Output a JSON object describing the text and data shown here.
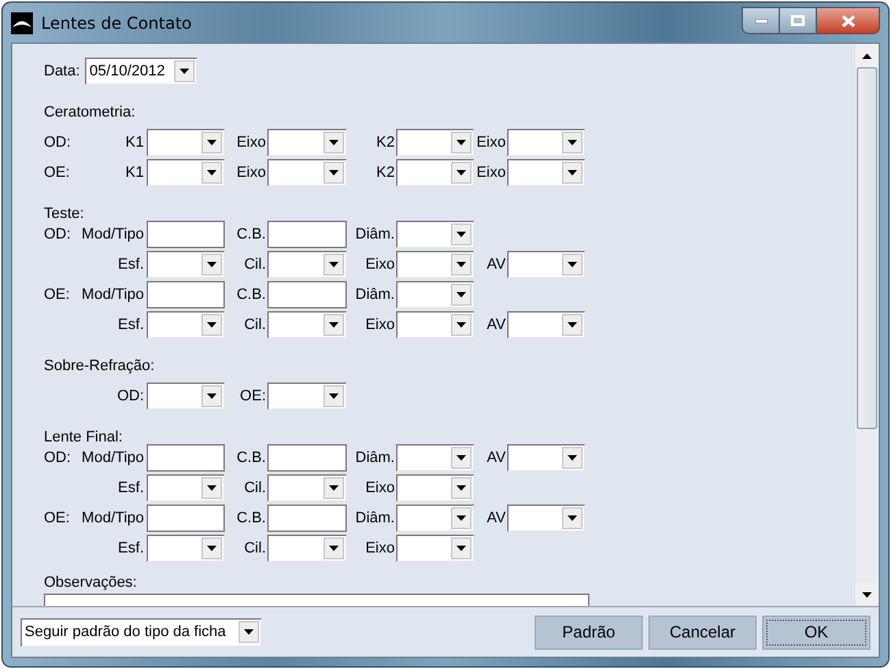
{
  "window": {
    "title": "Lentes de Contato"
  },
  "date": {
    "label": "Data:",
    "value": "05/10/2012"
  },
  "sections": [
    {
      "title": "Ceratometria:",
      "rows": [
        {
          "side": "OD:",
          "fields": [
            {
              "label": "K1",
              "kind": "combo"
            },
            {
              "label": "Eixo",
              "kind": "combo"
            },
            {
              "label": "K2",
              "kind": "combo"
            },
            {
              "label": "Eixo",
              "kind": "combo"
            }
          ]
        },
        {
          "side": "OE:",
          "fields": [
            {
              "label": "K1",
              "kind": "combo"
            },
            {
              "label": "Eixo",
              "kind": "combo"
            },
            {
              "label": "K2",
              "kind": "combo"
            },
            {
              "label": "Eixo",
              "kind": "combo"
            }
          ]
        }
      ]
    },
    {
      "title": "Teste:",
      "rows": [
        {
          "side": "OD:",
          "fields": [
            {
              "label": "Mod/Tipo",
              "kind": "text"
            },
            {
              "label": "C.B.",
              "kind": "text"
            },
            {
              "label": "Diâm.",
              "kind": "combo"
            }
          ]
        },
        {
          "fields": [
            {
              "label": "Esf.",
              "kind": "combo"
            },
            {
              "label": "Cil.",
              "kind": "combo"
            },
            {
              "label": "Eixo",
              "kind": "combo"
            },
            {
              "label": "AV",
              "kind": "combo"
            }
          ]
        },
        {
          "side": "OE:",
          "fields": [
            {
              "label": "Mod/Tipo",
              "kind": "text"
            },
            {
              "label": "C.B.",
              "kind": "text"
            },
            {
              "label": "Diâm.",
              "kind": "combo"
            }
          ]
        },
        {
          "fields": [
            {
              "label": "Esf.",
              "kind": "combo"
            },
            {
              "label": "Cil.",
              "kind": "combo"
            },
            {
              "label": "Eixo",
              "kind": "combo"
            },
            {
              "label": "AV",
              "kind": "combo"
            }
          ]
        }
      ]
    },
    {
      "title": "Sobre-Refração:",
      "rows": [
        {
          "fields": [
            {
              "label": "OD:",
              "kind": "combo"
            },
            {
              "label": "OE:",
              "kind": "combo"
            }
          ]
        }
      ]
    },
    {
      "title": "Lente Final:",
      "rows": [
        {
          "side": "OD:",
          "fields": [
            {
              "label": "Mod/Tipo",
              "kind": "text"
            },
            {
              "label": "C.B.",
              "kind": "text"
            },
            {
              "label": "Diâm.",
              "kind": "combo"
            },
            {
              "label": "AV",
              "kind": "combo"
            }
          ]
        },
        {
          "fields": [
            {
              "label": "Esf.",
              "kind": "combo"
            },
            {
              "label": "Cil.",
              "kind": "combo"
            },
            {
              "label": "Eixo",
              "kind": "combo"
            }
          ]
        },
        {
          "side": "OE:",
          "fields": [
            {
              "label": "Mod/Tipo",
              "kind": "text"
            },
            {
              "label": "C.B.",
              "kind": "text"
            },
            {
              "label": "Diâm.",
              "kind": "combo"
            },
            {
              "label": "AV",
              "kind": "combo"
            }
          ]
        },
        {
          "fields": [
            {
              "label": "Esf.",
              "kind": "combo"
            },
            {
              "label": "Cil.",
              "kind": "combo"
            },
            {
              "label": "Eixo",
              "kind": "combo"
            }
          ]
        }
      ]
    }
  ],
  "notes": {
    "label": "Observações:"
  },
  "footer": {
    "mode": {
      "value": "Seguir padrão do tipo da ficha"
    },
    "buttons": [
      {
        "label": "Padrão",
        "focused": false
      },
      {
        "label": "Cancelar",
        "focused": false
      },
      {
        "label": "OK",
        "focused": true
      }
    ]
  }
}
